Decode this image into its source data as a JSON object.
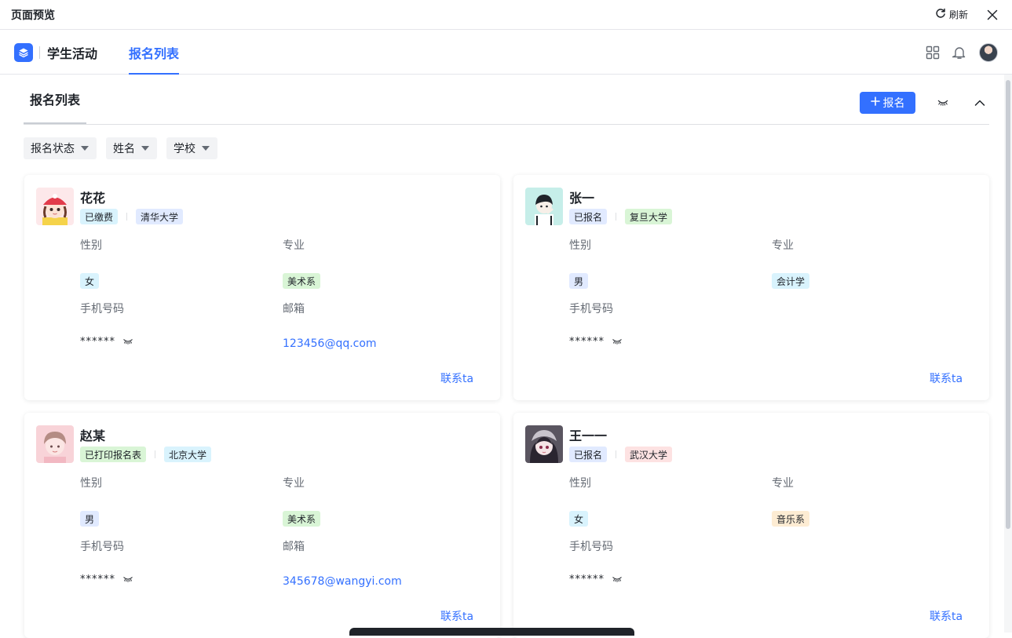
{
  "preview": {
    "title": "页面预览",
    "refresh_label": "刷新"
  },
  "nav": {
    "app_name": "学生活动",
    "active_tab": "报名列表"
  },
  "section": {
    "title": "报名列表",
    "add_button_label": "报名"
  },
  "filters": [
    "报名状态",
    "姓名",
    "学校"
  ],
  "labels": {
    "gender": "性别",
    "major": "专业",
    "phone": "手机号码",
    "email": "邮箱",
    "contact": "联系ta",
    "masked_phone": "******"
  },
  "colors": {
    "accent": "#3370ff",
    "tag_blue_bg": "#e1eaff",
    "tag_cyan_bg": "#d9f3fd",
    "tag_green_bg": "#d9f5d6",
    "tag_red_bg": "#fde2e2",
    "tag_orange_bg": "#fdecd3"
  },
  "cards": [
    {
      "name": "花花",
      "status": "已缴费",
      "school": "清华大学",
      "gender": "女",
      "major": "美术系",
      "phone_masked": "******",
      "email": "123456@qq.com",
      "avatar_icon": "girl-red-hat-avatar"
    },
    {
      "name": "张一",
      "status": "已报名",
      "school": "复旦大学",
      "gender": "男",
      "major": "会计学",
      "phone_masked": "******",
      "email": "",
      "avatar_icon": "boy-avatar"
    },
    {
      "name": "赵某",
      "status": "已打印报名表",
      "school": "北京大学",
      "gender": "男",
      "major": "美术系",
      "phone_masked": "******",
      "email": "345678@wangyi.com",
      "avatar_icon": "pink-boy-avatar"
    },
    {
      "name": "王一一",
      "status": "已报名",
      "school": "武汉大学",
      "gender": "女",
      "major": "音乐系",
      "phone_masked": "******",
      "email": "",
      "avatar_icon": "anime-girl-avatar"
    }
  ]
}
